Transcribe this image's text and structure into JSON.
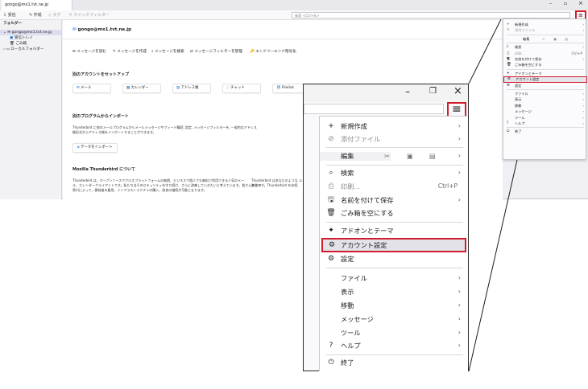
{
  "window": {
    "tab_title": "gongo@mx1.tvt.ne.jp",
    "toolbar": {
      "receive": "受信",
      "compose": "作成",
      "tags": "タグ",
      "quickfilter": "クイックフィルター"
    },
    "search_placeholder": "検索 <Ctrl+K>"
  },
  "folders": {
    "header": "フォルダー",
    "account": "gongo@mx1.tvt.ne.jp",
    "inbox": "受信トレイ",
    "trash": "ごみ箱",
    "local": "ローカルフォルダー"
  },
  "account_page": {
    "email": "gongo@mx1.tvt.ne.jp",
    "actions": [
      "メッセージを読む",
      "メッセージを作成",
      "メッセージを検索",
      "メッセージフィルターを管理",
      "エンドツーエンド暗号化"
    ],
    "setup_title": "別のアカウントをセットアップ",
    "setup_cards": [
      "メール",
      "カレンダー",
      "アドレス帳",
      "チャット",
      "Filelink"
    ],
    "import_title": "別のプログラムからインポート",
    "import_text1": "Thunderbird に他のメールプログラムからメールメッセージやフィード購読, 設定, メッセージフィルターを, 一般的なアドレス",
    "import_text2": "帳形式からアドレス帳をインポートすることができます。",
    "import_button": "データをインポート",
    "about_title": "Mozilla Thunderbird について",
    "about_text1": "Thunderbird は、オープンソースでクロスプラットフォームの無償、ビジネスで個人でも無料で利用できる人気のメー",
    "about_text2": "ル、カレンダークライアントです。私たちはそのセキュリティを守り続け、さらに改善していきたいと考えています。皆さんからの",
    "about_text3": "寄付によって、開発者の雇用、インフラストラクチャの購入、改良の継続が可能となります。",
    "about_right1": "Thunderbird はあなたのような ユー",
    "about_right2": "謝状です。Thunderbird を存続"
  },
  "small_menu": {
    "items": [
      {
        "icon": "+",
        "label": "新規作成",
        "arrow": true
      },
      {
        "icon": "⊘",
        "label": "添付ファイル",
        "arrow": true,
        "disabled": true
      },
      {
        "icon": "",
        "label": "編集",
        "edit_row": true
      },
      {
        "icon": "⌕",
        "label": "検索",
        "arrow": true
      },
      {
        "icon": "⎙",
        "label": "印刷...",
        "shortcut": "Ctrl+P",
        "disabled": true
      },
      {
        "icon": "🖫",
        "label": "名前を付けて保存",
        "arrow": true
      },
      {
        "icon": "🗑",
        "label": "ごみ箱を空にする"
      },
      {
        "icon": "✦",
        "label": "アドオンとテーマ"
      },
      {
        "icon": "⚙",
        "label": "アカウント設定",
        "highlight": true
      },
      {
        "icon": "⚙",
        "label": "設定"
      },
      {
        "icon": "",
        "label": "ファイル",
        "arrow": true
      },
      {
        "icon": "",
        "label": "表示",
        "arrow": true
      },
      {
        "icon": "",
        "label": "移動",
        "arrow": true
      },
      {
        "icon": "",
        "label": "メッセージ",
        "arrow": true
      },
      {
        "icon": "",
        "label": "ツール",
        "arrow": true
      },
      {
        "icon": "?",
        "label": "ヘルプ",
        "arrow": true
      },
      {
        "icon": "⏻",
        "label": "終了"
      }
    ]
  },
  "zoom_menu": {
    "new": "新規作成",
    "attach": "添付ファイル",
    "edit": "編集",
    "search": "検索",
    "print": "印刷...",
    "print_shortcut": "Ctrl+P",
    "saveas": "名前を付けて保存",
    "emptytrash": "ごみ箱を空にする",
    "addons": "アドオンとテーマ",
    "account_settings": "アカウント設定",
    "settings": "設定",
    "file": "ファイル",
    "view": "表示",
    "go": "移動",
    "message": "メッセージ",
    "tools": "ツール",
    "help": "ヘルプ",
    "quit": "終了"
  },
  "colors": {
    "highlight": "#d21c2c",
    "accent": "#0a62d0"
  }
}
